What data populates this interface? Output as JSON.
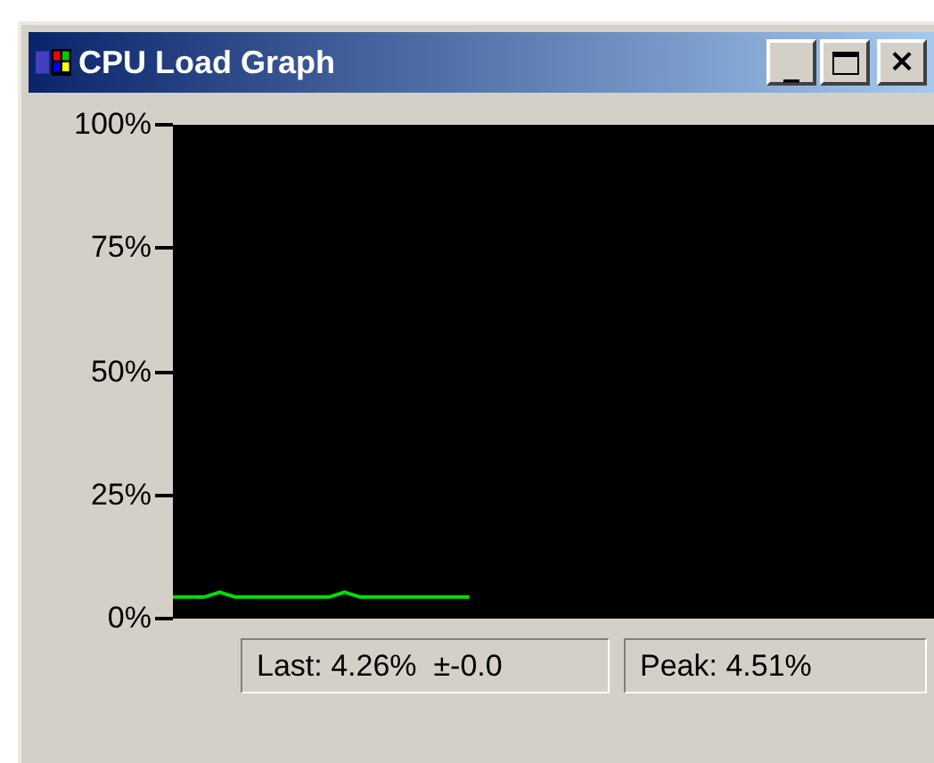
{
  "window": {
    "title": "CPU Load Graph",
    "buttons": [
      {
        "kind": "minimize",
        "label": "_"
      },
      {
        "kind": "maximize"
      },
      {
        "kind": "close",
        "label": "×"
      }
    ]
  },
  "graph": {
    "chart_data": {
      "type": "line",
      "ylim": [
        0,
        100
      ],
      "yticks": [
        {
          "value": 0,
          "label": "0%"
        },
        {
          "value": 25,
          "label": "25%"
        },
        {
          "value": 50,
          "label": "50%"
        },
        {
          "value": 75,
          "label": "75%"
        },
        {
          "value": 100,
          "label": "100%"
        }
      ],
      "series": [
        {
          "color": "#00e000",
          "values": [
            4,
            4,
            4,
            5,
            4,
            4,
            4,
            4,
            4,
            4,
            4,
            5,
            4,
            4,
            4,
            4,
            4,
            4,
            4,
            4
          ]
        }
      ]
    }
  },
  "status_bar": [
    {
      "text": "Last: 4.26%  ±-0.0"
    },
    {
      "text": "Peak: 4.51%"
    }
  ]
}
